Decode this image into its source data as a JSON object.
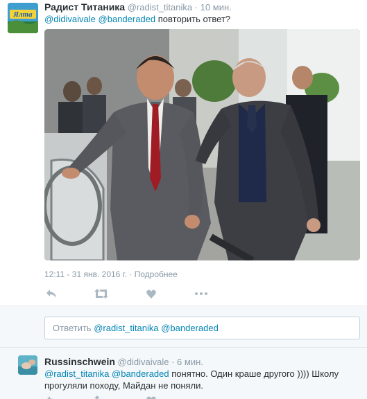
{
  "tweet": {
    "author_name": "Радист Титаника",
    "author_handle": "@radist_titanika",
    "separator": "·",
    "time": "10 мин.",
    "avatar_text": "Ялта",
    "reply_prefix_mentions": [
      "@didivaivale",
      "@banderaded"
    ],
    "text": "повторить ответ?",
    "timestamp": "12:11 - 31 янв. 2016 г.",
    "details_link": "Подробнее",
    "actions": [
      {
        "name": "reply-icon"
      },
      {
        "name": "retweet-icon"
      },
      {
        "name": "like-icon"
      },
      {
        "name": "more-icon"
      }
    ]
  },
  "reply_box": {
    "prefix": "Ответить",
    "mentions": "@radist_titanika @banderaded"
  },
  "reply_tweet": {
    "author_name": "Russinschwein",
    "author_handle": "@didivaivale",
    "separator": "·",
    "time": "6 мин.",
    "mentions": "@radist_titanika @banderaded",
    "text": "понятно. Один краше другого )))) Школу прогуляли походу, Майдан не поняли."
  },
  "colors": {
    "link": "#0084b4",
    "muted": "#8899a6",
    "text": "#292f33"
  }
}
